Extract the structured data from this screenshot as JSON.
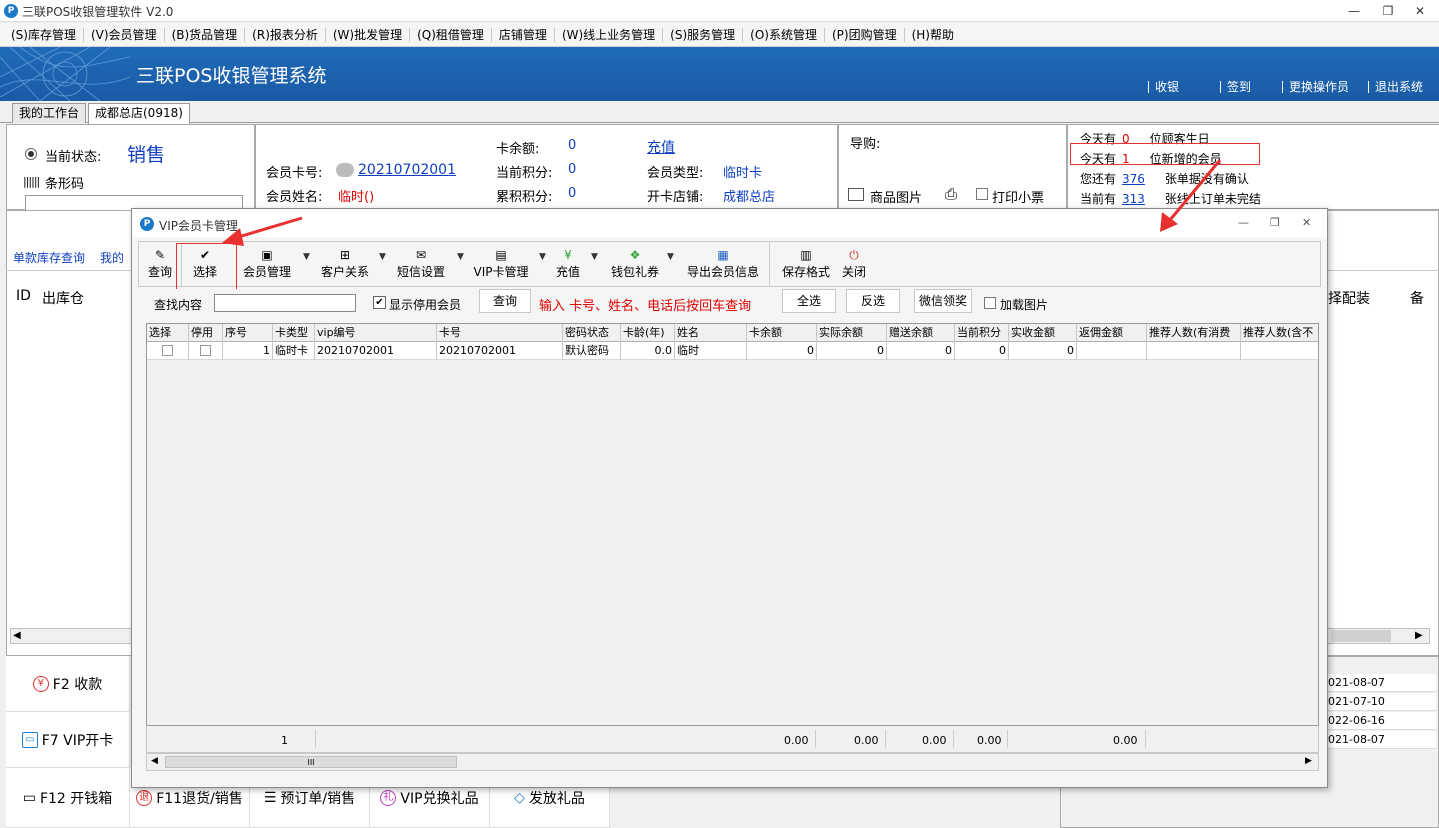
{
  "window": {
    "title": "三联POS收银管理软件 V2.0",
    "minimize": "—",
    "restore": "❐",
    "close": "✕"
  },
  "menu": [
    "(S)库存管理",
    "(V)会员管理",
    "(B)货品管理",
    "(R)报表分析",
    "(W)批发管理",
    "(Q)租借管理",
    "店铺管理",
    "(W)线上业务管理",
    "(S)服务管理",
    "(O)系统管理",
    "(P)团购管理",
    "(H)帮助"
  ],
  "banner": {
    "title": "三联POS收银管理系统",
    "links": [
      "收银",
      "签到",
      "更换操作员",
      "退出系统"
    ]
  },
  "tabs": [
    "我的工作台",
    "成都总店(0918)"
  ],
  "status": {
    "label": "当前状态:",
    "value": "销售",
    "barcode_label": "条形码"
  },
  "member": {
    "card_label": "会员卡号:",
    "card_no": "20210702001",
    "name_label": "会员姓名:",
    "name": "临时()",
    "balance_label": "卡余额:",
    "balance": "0",
    "points_label": "当前积分:",
    "points": "0",
    "total_points_label": "累积积分:",
    "total_points": "0",
    "recharge": "充值",
    "type_label": "会员类型:",
    "type": "临时卡",
    "shop_label": "开卡店铺:",
    "shop": "成都总店"
  },
  "guide": {
    "label": "导购:",
    "goods_image": "商品图片",
    "print_receipt": "打印小票"
  },
  "notices": [
    {
      "prefix": "今天有",
      "num": "0",
      "suffix": "位顾客生日"
    },
    {
      "prefix": "今天有",
      "num": "1",
      "suffix": "位新增的会员"
    },
    {
      "prefix": "您还有",
      "num": "376",
      "suffix": "张单据没有确认"
    },
    {
      "prefix": "当前有",
      "num": "313",
      "suffix": "张线上订单未完结"
    }
  ],
  "left_panel": {
    "links": [
      "单款库存查询",
      "我的"
    ],
    "col_id": "ID",
    "col_out": "出库仓"
  },
  "right_panel": {
    "col_a": "择配装",
    "col_b": "备",
    "dates": [
      "021-08-07",
      "021-07-10",
      "022-06-16",
      "021-08-07"
    ]
  },
  "fkeys": [
    "F2 收款",
    "F7 VIP开卡",
    "F12 开钱箱",
    "F11退货/销售",
    "预订单/销售",
    "VIP兑换礼品",
    "发放礼品"
  ],
  "dialog": {
    "title": "VIP会员卡管理",
    "toolbar": [
      "查询",
      "选择",
      "会员管理",
      "客户关系",
      "短信设置",
      "VIP卡管理",
      "充值",
      "钱包礼券",
      "导出会员信息",
      "保存格式",
      "关闭"
    ],
    "search": {
      "label": "查找内容",
      "value": "",
      "show_disabled": "显示停用会员",
      "query": "查询",
      "hint": "输入 卡号、姓名、电话后按回车查询",
      "select_all": "全选",
      "invert": "反选",
      "wechat": "微信领奖",
      "load_images": "加载图片"
    },
    "columns": [
      "选择",
      "停用",
      "序号",
      "卡类型",
      "vip编号",
      "卡号",
      "密码状态",
      "卡龄(年)",
      "姓名",
      "卡余额",
      "实际余额",
      "赠送余额",
      "当前积分",
      "实收金额",
      "返佣金额",
      "推荐人数(有消费",
      "推荐人数(含不"
    ],
    "rows": [
      [
        "",
        "",
        "1",
        "临时卡",
        "20210702001",
        "20210702001",
        "默认密码",
        "0.0",
        "临时",
        "0",
        "0",
        "0",
        "0",
        "0",
        "",
        "",
        ""
      ]
    ],
    "footer": {
      "count": "1",
      "v1": "0.00",
      "v2": "0.00",
      "v3": "0.00",
      "v4": "0.00",
      "v5": "0.00"
    },
    "scroll_mark": "III"
  },
  "colors": {
    "banner": "#1f6bb8",
    "link": "#1040c0",
    "alert": "#e00000",
    "annot": "#e83030"
  }
}
